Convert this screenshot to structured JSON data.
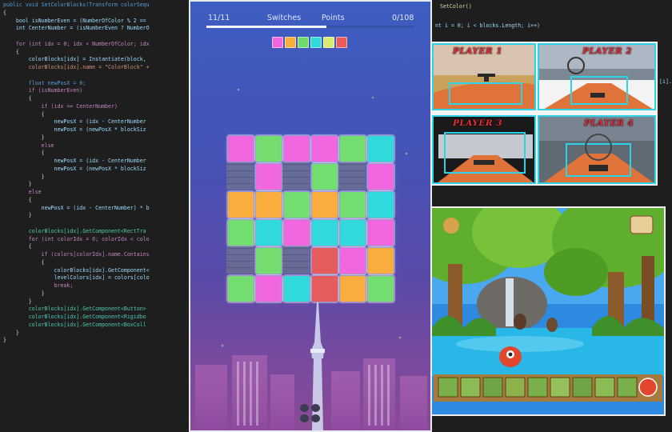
{
  "code_left": [
    {
      "t": "public void SetColorBlocks(Transform colorSequ",
      "c": "#569cd6"
    },
    {
      "t": "{",
      "c": "#d4d4d4"
    },
    {
      "t": "    bool isNumberEven = (NumberOfColor % 2 ==",
      "c": "#9cdcfe"
    },
    {
      "t": "    int CenterNumber = (isNumberEven ? NumberO",
      "c": "#9cdcfe"
    },
    {
      "t": "",
      "c": "#d4d4d4"
    },
    {
      "t": "    for (int idx = 0; idx < NumberOfColor; idx",
      "c": "#c586c0"
    },
    {
      "t": "    {",
      "c": "#d4d4d4"
    },
    {
      "t": "        colorBlocks[idx] = Instantiate(block,",
      "c": "#9cdcfe"
    },
    {
      "t": "        colorBlocks[idx].name = \"ColorBlock\" +",
      "c": "#ce9178"
    },
    {
      "t": "",
      "c": "#d4d4d4"
    },
    {
      "t": "        float newPosX = 0;",
      "c": "#569cd6"
    },
    {
      "t": "        if (isNumberEven)",
      "c": "#c586c0"
    },
    {
      "t": "        {",
      "c": "#d4d4d4"
    },
    {
      "t": "            if (idx == CenterNumber)",
      "c": "#c586c0"
    },
    {
      "t": "            {",
      "c": "#d4d4d4"
    },
    {
      "t": "                newPosX = (idx - CenterNumber",
      "c": "#9cdcfe"
    },
    {
      "t": "                newPosX = (newPosX * blockSiz",
      "c": "#9cdcfe"
    },
    {
      "t": "            }",
      "c": "#d4d4d4"
    },
    {
      "t": "            else",
      "c": "#c586c0"
    },
    {
      "t": "            {",
      "c": "#d4d4d4"
    },
    {
      "t": "                newPosX = (idx - CenterNumber",
      "c": "#9cdcfe"
    },
    {
      "t": "                newPosX = (newPosX * blockSiz",
      "c": "#9cdcfe"
    },
    {
      "t": "            }",
      "c": "#d4d4d4"
    },
    {
      "t": "        }",
      "c": "#d4d4d4"
    },
    {
      "t": "        else",
      "c": "#c586c0"
    },
    {
      "t": "        {",
      "c": "#d4d4d4"
    },
    {
      "t": "            newPosX = (idx - CenterNumber) * b",
      "c": "#9cdcfe"
    },
    {
      "t": "        }",
      "c": "#d4d4d4"
    },
    {
      "t": "",
      "c": "#d4d4d4"
    },
    {
      "t": "        colorBlocks[idx].GetComponent<RectTra",
      "c": "#4ec9b0"
    },
    {
      "t": "        for (int colorIdx = 0; colorIdx < colo",
      "c": "#c586c0"
    },
    {
      "t": "        {",
      "c": "#d4d4d4"
    },
    {
      "t": "            if (colors[colorIdx].name.Contains",
      "c": "#c586c0"
    },
    {
      "t": "            {",
      "c": "#d4d4d4"
    },
    {
      "t": "                colorBlocks[idx].GetComponent<",
      "c": "#9cdcfe"
    },
    {
      "t": "                levelColors[idx] = colors[colo",
      "c": "#9cdcfe"
    },
    {
      "t": "                break;",
      "c": "#c586c0"
    },
    {
      "t": "            }",
      "c": "#d4d4d4"
    },
    {
      "t": "        }",
      "c": "#d4d4d4"
    },
    {
      "t": "        colorBlocks[idx].GetComponent<Button>",
      "c": "#4ec9b0"
    },
    {
      "t": "        colorBlocks[idx].GetComponent<Rigidbo",
      "c": "#4ec9b0"
    },
    {
      "t": "        colorBlocks[idx].GetComponent<BoxColl",
      "c": "#4ec9b0"
    },
    {
      "t": "    }",
      "c": "#d4d4d4"
    },
    {
      "t": "}",
      "c": "#d4d4d4"
    }
  ],
  "code_right_frags": [
    {
      "t": "SetColor()",
      "c": "#dcdcaa"
    },
    {
      "t": "nt i = 0; i < blocks.Length; i++)",
      "c": "#9cdcfe"
    },
    {
      "t": "[i].",
      "c": "#9cdcfe"
    }
  ],
  "hud": {
    "level": "11/11",
    "tab_switches": "Switches",
    "tab_points": "Points",
    "points": "0/108"
  },
  "sequence_colors": [
    "#f067e0",
    "#f8ad3c",
    "#6fd96a",
    "#2fd9dc",
    "#d7ec6e",
    "#ea5b5b"
  ],
  "palette": {
    "pink": "#f067e0",
    "green": "#74dd70",
    "cyan": "#2fd9dc",
    "orange": "#f8ad3c",
    "red": "#e65c5c"
  },
  "board": [
    [
      "pink",
      "green",
      "pink",
      "pink",
      "green",
      "cyan"
    ],
    [
      "brick",
      "pink",
      "brick",
      "green",
      "brick",
      "pink"
    ],
    [
      "orange",
      "orange",
      "green",
      "orange",
      "green",
      "cyan"
    ],
    [
      "green",
      "cyan",
      "pink",
      "cyan",
      "cyan",
      "pink"
    ],
    [
      "brick",
      "green",
      "brick",
      "red",
      "pink",
      "orange"
    ],
    [
      "green",
      "pink",
      "cyan",
      "red",
      "orange",
      "green"
    ]
  ],
  "race_players": [
    "PLAYER 1",
    "PLAYER 2",
    "PLAYER 3",
    "PLAYER 4"
  ]
}
